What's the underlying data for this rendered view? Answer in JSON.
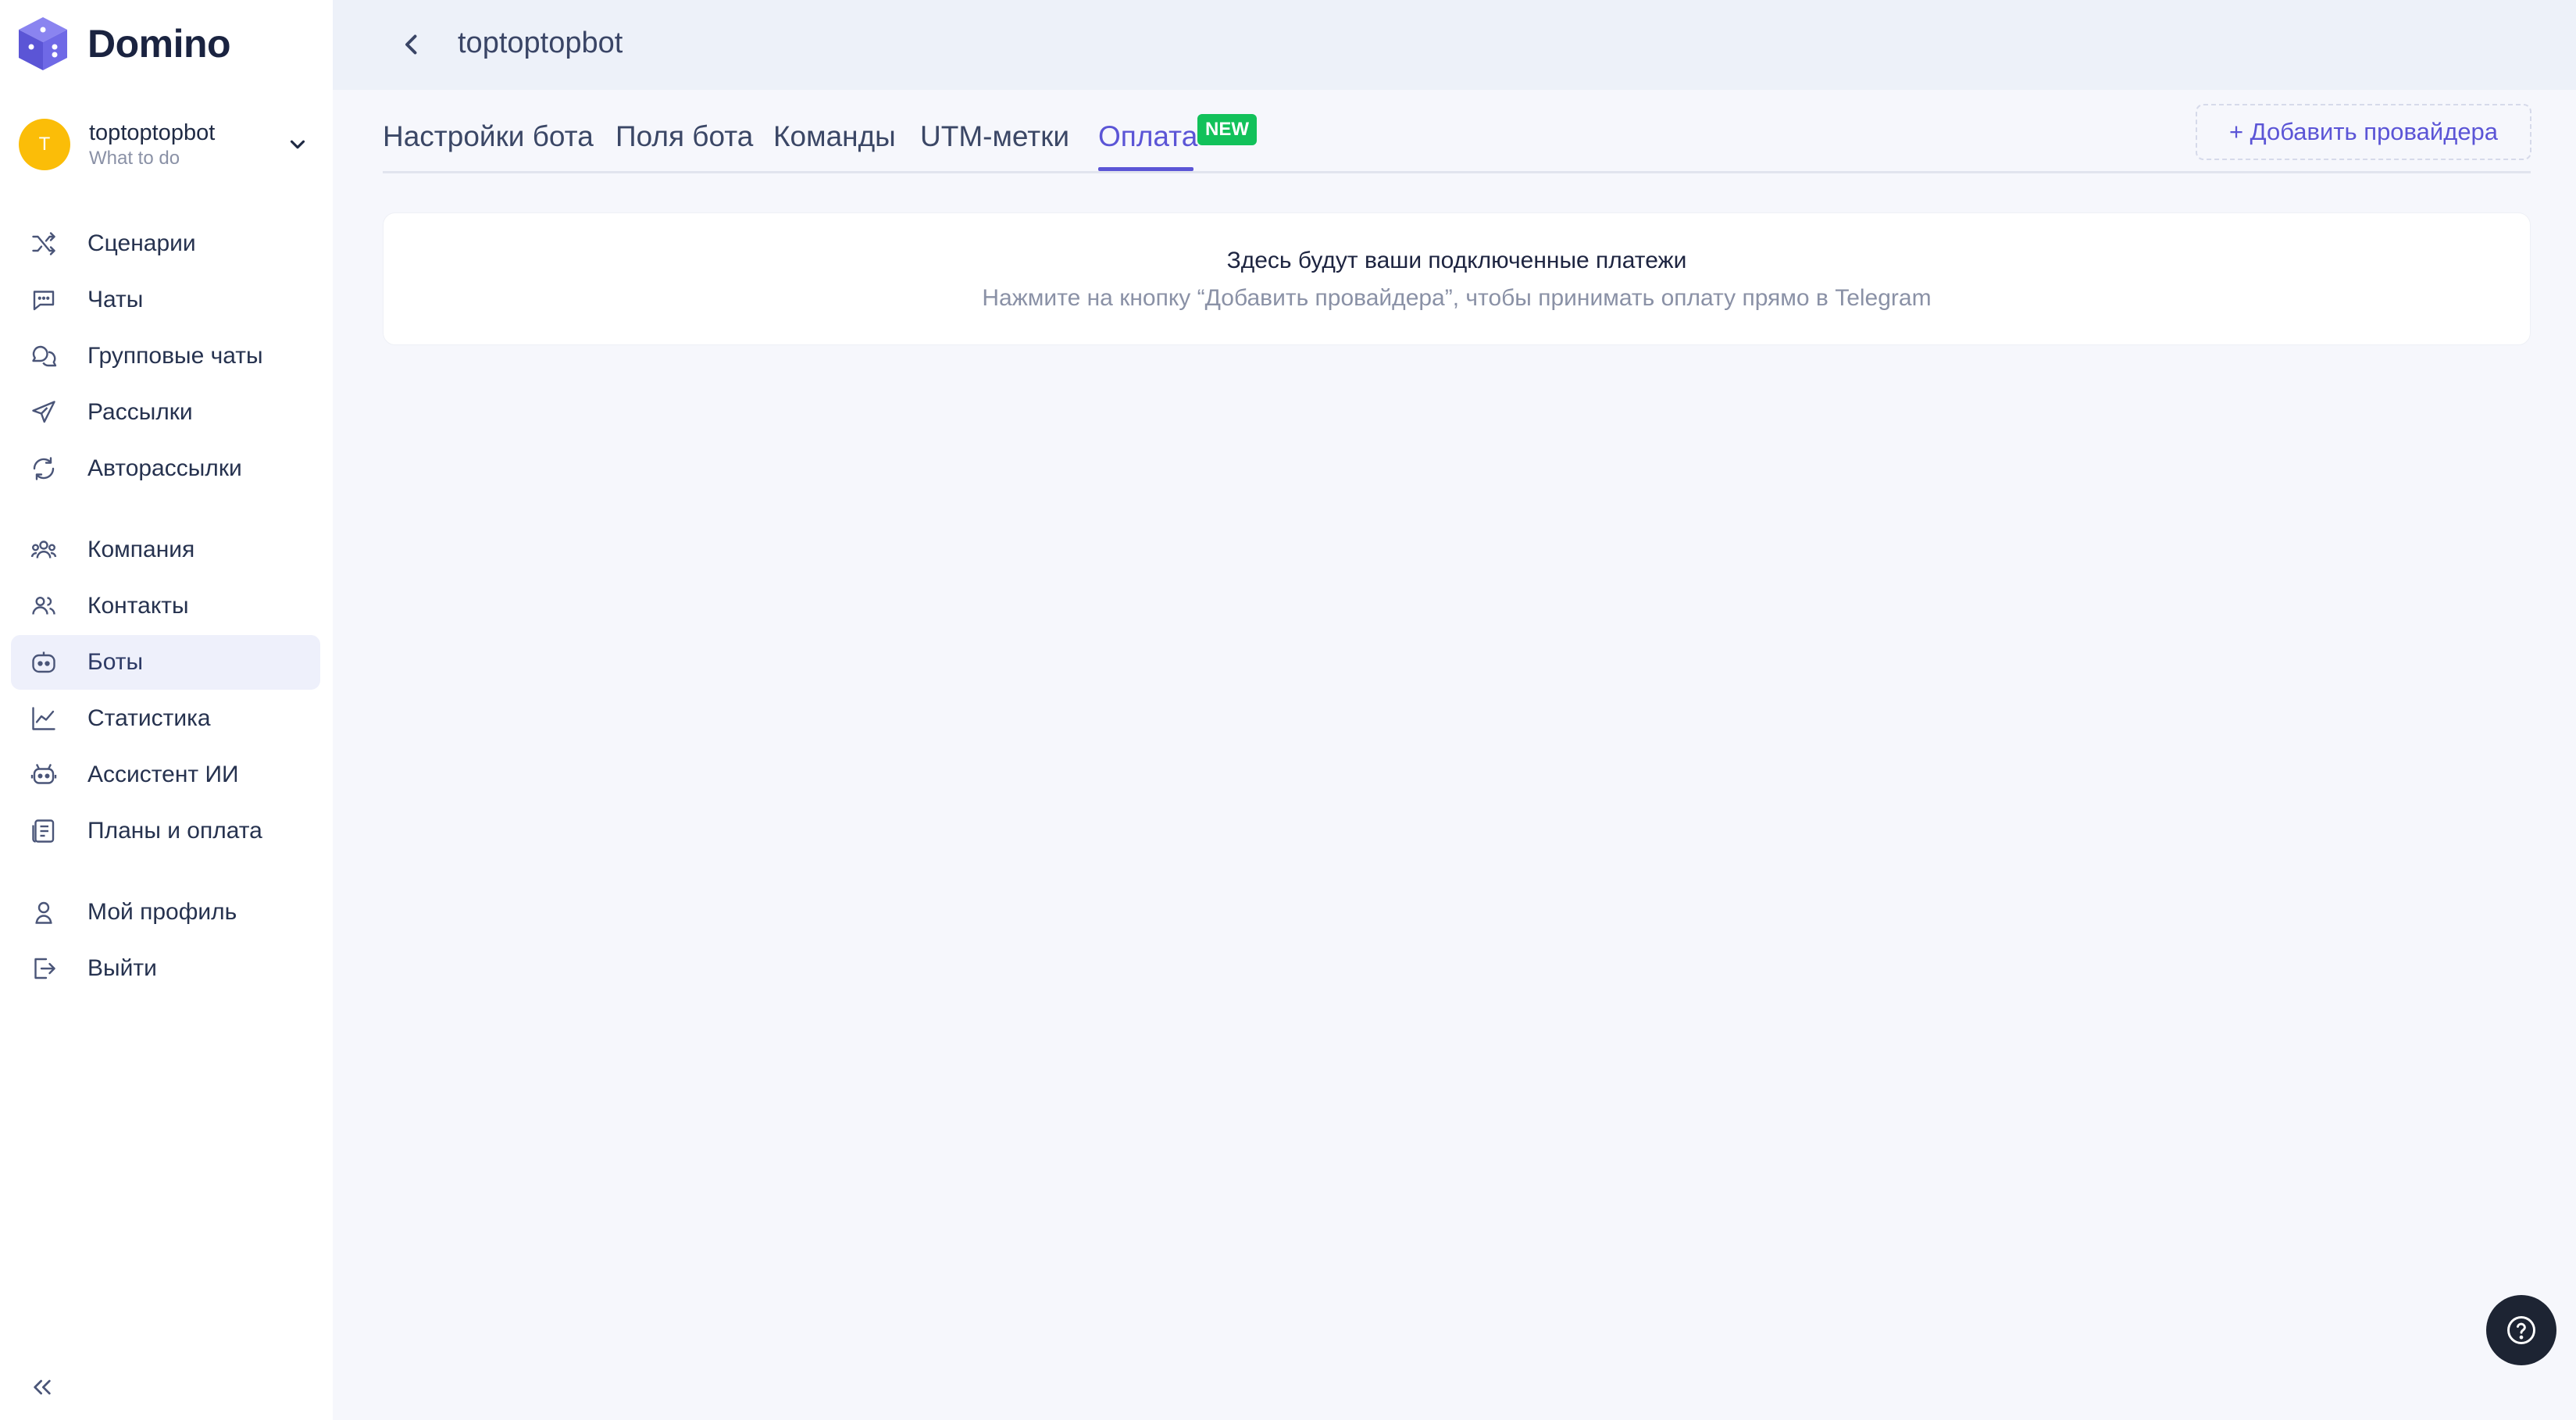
{
  "app": {
    "name": "Domino"
  },
  "account": {
    "avatar_letter": "T",
    "name": "toptoptopbot",
    "subtitle": "What to do"
  },
  "sidebar": {
    "items": [
      {
        "label": "Сценарии",
        "icon": "shuffle-icon"
      },
      {
        "label": "Чаты",
        "icon": "chat-icon"
      },
      {
        "label": "Групповые чаты",
        "icon": "group-chat-icon"
      },
      {
        "label": "Рассылки",
        "icon": "send-icon"
      },
      {
        "label": "Авторассылки",
        "icon": "auto-send-icon"
      },
      {
        "label": "Компания",
        "icon": "company-icon"
      },
      {
        "label": "Контакты",
        "icon": "contacts-icon"
      },
      {
        "label": "Боты",
        "icon": "bot-icon",
        "active": true
      },
      {
        "label": "Статистика",
        "icon": "chart-icon"
      },
      {
        "label": "Ассистент ИИ",
        "icon": "ai-assistant-icon"
      },
      {
        "label": "Планы и оплата",
        "icon": "billing-icon"
      },
      {
        "label": "Мой профиль",
        "icon": "profile-icon"
      },
      {
        "label": "Выйти",
        "icon": "logout-icon"
      }
    ]
  },
  "header": {
    "title": "toptoptopbot"
  },
  "tabs": [
    {
      "label": "Настройки бота"
    },
    {
      "label": "Поля бота"
    },
    {
      "label": "Команды"
    },
    {
      "label": "UTM-метки"
    },
    {
      "label": "Оплата",
      "active": true,
      "badge": "NEW"
    }
  ],
  "actions": {
    "add_provider": "+ Добавить провайдера"
  },
  "empty_state": {
    "title": "Здесь будут ваши подключенные платежи",
    "subtitle": "Нажмите на кнопку “Добавить провайдера”, чтобы принимать оплату прямо в Telegram"
  },
  "colors": {
    "accent": "#5b55d6",
    "badge": "#12c15a",
    "avatar": "#fbbd08",
    "help_button": "#1d2433"
  }
}
